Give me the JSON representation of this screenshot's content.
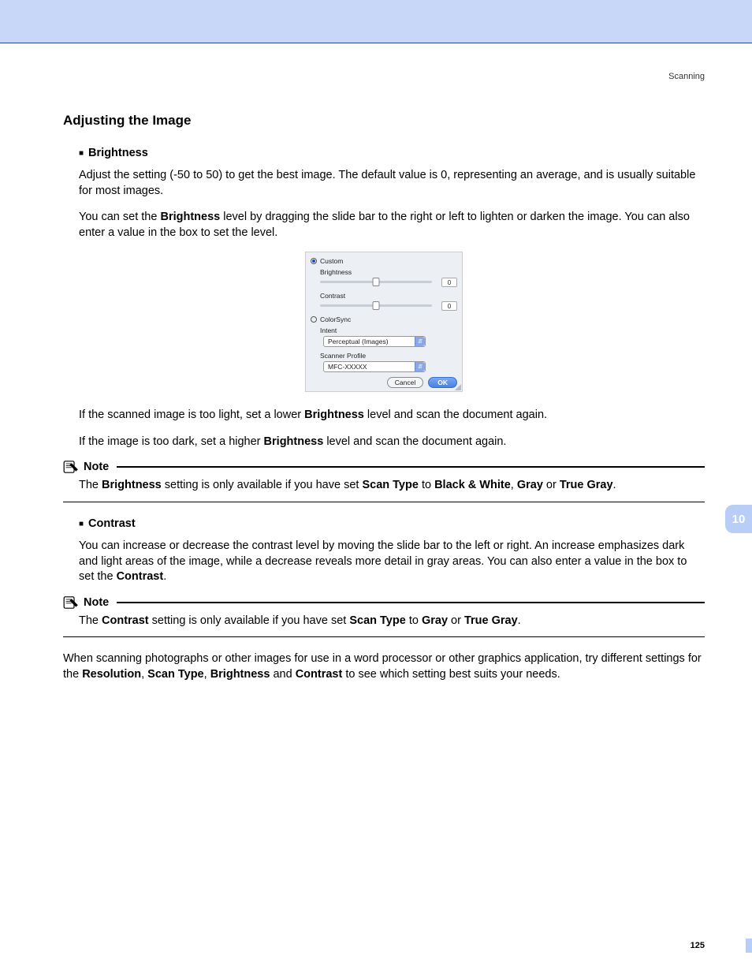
{
  "header_label": "Scanning",
  "title": "Adjusting the Image",
  "brightness": {
    "heading": "Brightness",
    "p1a": "Adjust the setting (-50 to 50) to get the best image. The default value is 0, representing an average, and is usually suitable for most images.",
    "p2a": "You can set the ",
    "p2b": "Brightness",
    "p2c": " level by dragging the slide bar to the right or left to lighten or darken the image. You can also enter a value in the box to set the level.",
    "p3a": "If the scanned image is too light, set a lower ",
    "p3b": "Brightness",
    "p3c": " level and scan the document again.",
    "p4a": "If the image is too dark, set a higher ",
    "p4b": "Brightness",
    "p4c": " level and scan the document again."
  },
  "note1": {
    "label": "Note",
    "a": "The ",
    "b": "Brightness",
    "c": " setting is only available if you have set ",
    "d": "Scan Type",
    "e": " to ",
    "f": "Black & White",
    "g": ", ",
    "h": "Gray",
    "i": " or ",
    "j": "True Gray",
    "k": "."
  },
  "contrast": {
    "heading": "Contrast",
    "p1a": "You can increase or decrease the contrast level by moving the slide bar to the left or right. An increase emphasizes dark and light areas of the image, while a decrease reveals more detail in gray areas. You can also enter a value in the box to set the ",
    "p1b": "Contrast",
    "p1c": "."
  },
  "note2": {
    "label": "Note",
    "a": "The ",
    "b": "Contrast",
    "c": " setting is only available if you have set ",
    "d": "Scan Type",
    "e": " to ",
    "f": "Gray",
    "g": " or ",
    "h": "True Gray",
    "i": "."
  },
  "closing": {
    "a": "When scanning photographs or other images for use in a word processor or other graphics application, try different settings for the ",
    "b": "Resolution",
    "c": ", ",
    "d": "Scan Type",
    "e": ", ",
    "f": "Brightness",
    "g": " and ",
    "h": "Contrast",
    "i": " to see which setting best suits your needs."
  },
  "dialog": {
    "custom": "Custom",
    "brightness_label": "Brightness",
    "brightness_value": "0",
    "contrast_label": "Contrast",
    "contrast_value": "0",
    "colorsync": "ColorSync",
    "intent_label": "Intent",
    "intent_value": "Perceptual (Images)",
    "profile_label": "Scanner Profile",
    "profile_value": "MFC-XXXXX",
    "cancel": "Cancel",
    "ok": "OK"
  },
  "side_tab": "10",
  "page_num": "125"
}
